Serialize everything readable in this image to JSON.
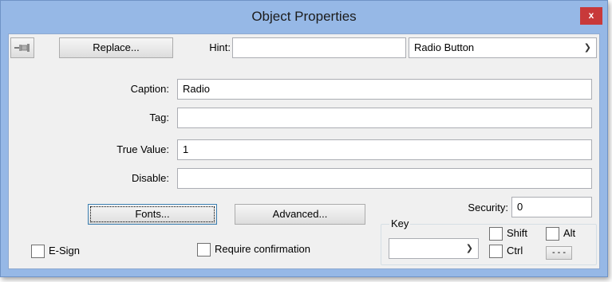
{
  "window": {
    "title": "Object Properties",
    "close_label": "x"
  },
  "toolbar": {
    "pin_icon": "pushpin-icon",
    "replace_label": "Replace...",
    "hint_label": "Hint:",
    "hint_value": "",
    "type_select_value": "Radio Button"
  },
  "fields": {
    "caption_label": "Caption:",
    "caption_value": "Radio",
    "tag_label": "Tag:",
    "tag_value": "",
    "true_value_label": "True Value:",
    "true_value_value": "1",
    "disable_label": "Disable:",
    "disable_value": ""
  },
  "buttons": {
    "fonts_label": "Fonts...",
    "advanced_label": "Advanced..."
  },
  "security": {
    "label": "Security:",
    "value": "0"
  },
  "checkboxes": {
    "esign_label": "E-Sign",
    "require_confirmation_label": "Require confirmation"
  },
  "key_group": {
    "title": "Key",
    "key_value": "",
    "shift_label": "Shift",
    "alt_label": "Alt",
    "ctrl_label": "Ctrl",
    "more_label": "- - -"
  },
  "colors": {
    "frame": "#96b8e6",
    "close": "#c8393a",
    "client": "#f0f0f0"
  }
}
